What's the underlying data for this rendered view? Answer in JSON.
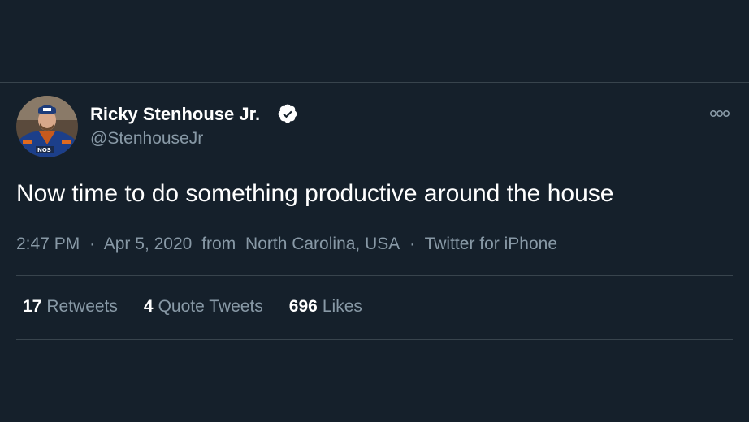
{
  "user": {
    "display_name": "Ricky Stenhouse Jr.",
    "handle": "@StenhouseJr",
    "verified": true,
    "avatar_icon": "racing-driver-avatar"
  },
  "tweet": {
    "text": "Now time to do something productive around the house",
    "time": "2:47 PM",
    "date": "Apr 5, 2020",
    "location_prefix": "from",
    "location": "North Carolina, USA",
    "source": "Twitter for iPhone",
    "separator": "·"
  },
  "stats": {
    "retweets": {
      "count": "17",
      "label": "Retweets"
    },
    "quote_tweets": {
      "count": "4",
      "label": "Quote Tweets"
    },
    "likes": {
      "count": "696",
      "label": "Likes"
    }
  },
  "colors": {
    "background": "#15202b",
    "primary_text": "#ffffff",
    "secondary_text": "#8899a6",
    "divider": "#38444d"
  }
}
